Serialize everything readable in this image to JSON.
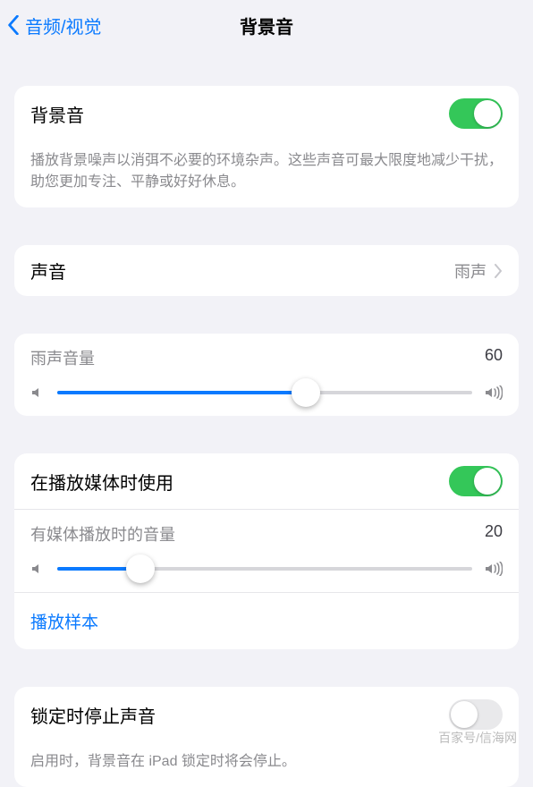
{
  "nav": {
    "back_label": "音频/视觉",
    "title": "背景音"
  },
  "group1": {
    "row_title": "背景音",
    "switch_on": true,
    "note": "播放背景噪声以消弭不必要的环境杂声。这些声音可最大限度地减少干扰，助您更加专注、平静或好好休息。"
  },
  "group2": {
    "label": "声音",
    "value": "雨声"
  },
  "group3": {
    "slider_label": "雨声音量",
    "slider_value": 60,
    "slider_percent": 60
  },
  "group4": {
    "row_title": "在播放媒体时使用",
    "switch_on": true,
    "media_slider_label": "有媒体播放时的音量",
    "media_slider_value": 20,
    "media_slider_percent": 20,
    "sample_link": "播放样本"
  },
  "group5": {
    "row_title": "锁定时停止声音",
    "switch_on": false,
    "note": "启用时，背景音在 iPad 锁定时将会停止。"
  },
  "watermark": "百家号/信海网"
}
